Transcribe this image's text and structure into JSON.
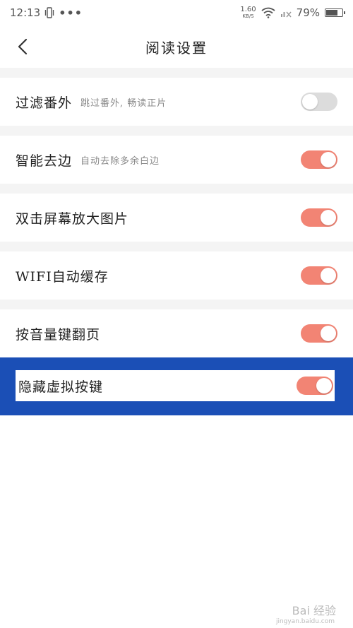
{
  "status_bar": {
    "time": "12:13",
    "more": "•••",
    "net_speed_value": "1.60",
    "net_speed_unit": "KB/S",
    "battery_percent": "79%",
    "battery_level": 0.79
  },
  "header": {
    "title": "阅读设置",
    "back_icon": "chevron-left-icon"
  },
  "settings": [
    {
      "label": "过滤番外",
      "desc": "跳过番外, 畅读正片",
      "enabled": false
    },
    {
      "label": "智能去边",
      "desc": "自动去除多余白边",
      "enabled": true
    },
    {
      "label": "双击屏幕放大图片",
      "desc": "",
      "enabled": true
    },
    {
      "label": "WIFI自动缓存",
      "desc": "",
      "enabled": true
    },
    {
      "label": "按音量键翻页",
      "desc": "",
      "enabled": true
    },
    {
      "label": "隐藏虚拟按键",
      "desc": "",
      "enabled": true
    }
  ],
  "colors": {
    "toggle_on": "#f28474",
    "toggle_off": "#dcdcdc",
    "highlight": "#1b4fb6"
  },
  "watermark": {
    "text": "Bai 经验",
    "sub": "jingyan.baidu.com"
  }
}
